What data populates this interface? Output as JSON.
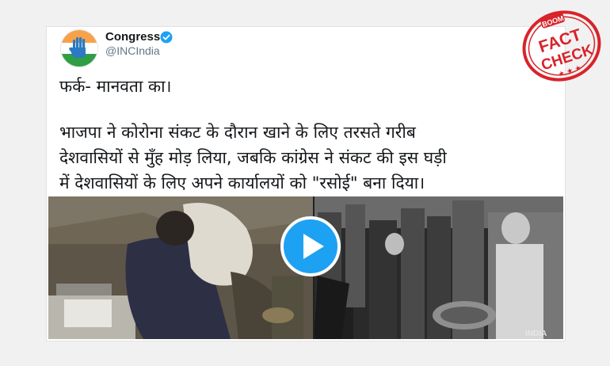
{
  "tweet": {
    "author_name": "Congress",
    "author_handle": "@INCIndia",
    "verified": true,
    "lines": [
      "फर्क- मानवता का।",
      "भाजपा ने कोरोना संकट के दौरान खाने के लिए तरसते गरीब",
      "देशवासियों से मुँह मोड़ लिया, जबकि कांग्रेस ने संकट की इस घड़ी",
      "में देशवासियों के लिए अपने कार्यालयों को \"रसोई\" बना दिया।"
    ]
  },
  "video": {
    "watermark": "INDIA"
  },
  "stamp": {
    "brand": "BOOM",
    "word1": "FACT",
    "word2": "CHECK"
  },
  "colors": {
    "play": "#1da1f2",
    "stamp": "#d8232a",
    "verified": "#1da1f2"
  }
}
